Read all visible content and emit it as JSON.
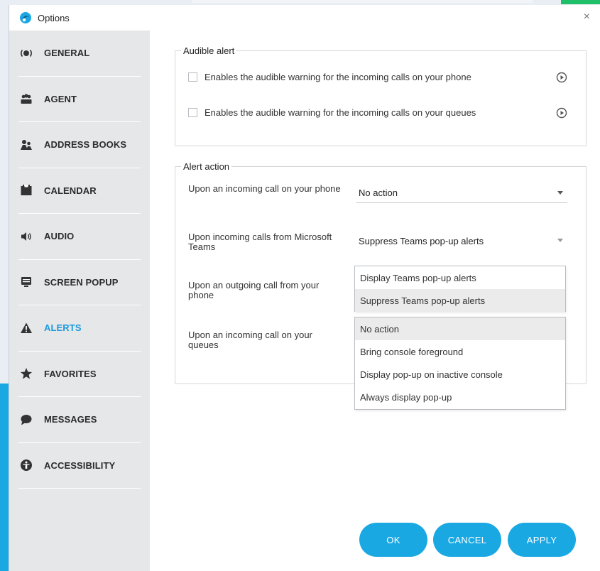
{
  "window": {
    "title": "Options",
    "close_glyph": "×"
  },
  "sidebar": {
    "items": [
      {
        "label": "GENERAL",
        "icon": "radio-icon"
      },
      {
        "label": "AGENT",
        "icon": "agents-icon"
      },
      {
        "label": "ADDRESS BOOKS",
        "icon": "address-book-icon"
      },
      {
        "label": "CALENDAR",
        "icon": "calendar-icon"
      },
      {
        "label": "AUDIO",
        "icon": "speaker-icon"
      },
      {
        "label": "SCREEN POPUP",
        "icon": "screen-popup-icon"
      },
      {
        "label": "ALERTS",
        "icon": "warning-icon",
        "active": true
      },
      {
        "label": "FAVORITES",
        "icon": "star-icon"
      },
      {
        "label": "MESSAGES",
        "icon": "chat-bubble-icon"
      },
      {
        "label": "ACCESSIBILITY",
        "icon": "accessibility-icon"
      }
    ]
  },
  "audible_alert": {
    "legend": "Audible alert",
    "phone_label": "Enables the audible warning for the incoming calls on your phone",
    "queues_label": "Enables the audible warning for the incoming calls on your queues",
    "phone_checked": false,
    "queues_checked": false
  },
  "alert_action": {
    "legend": "Alert action",
    "rows": [
      {
        "label": "Upon an incoming call on your phone",
        "value": "No action"
      },
      {
        "label": "Upon incoming calls from Microsoft Teams",
        "value": "Suppress Teams pop-up alerts"
      },
      {
        "label": "Upon an outgoing call from your phone",
        "value": ""
      },
      {
        "label": "Upon an incoming call on your queues",
        "value": ""
      }
    ]
  },
  "teams_dropdown": {
    "options": [
      "Display Teams pop-up alerts",
      "Suppress Teams pop-up alerts"
    ],
    "selected": "Suppress Teams pop-up alerts"
  },
  "action_dropdown": {
    "options": [
      "No action",
      "Bring console foreground",
      "Display pop-up on inactive console",
      "Always display pop-up"
    ],
    "selected": "No action"
  },
  "buttons": {
    "ok": "OK",
    "cancel": "CANCEL",
    "apply": "APPLY"
  },
  "colors": {
    "accent": "#1aa8e3",
    "active_nav": "#1a9be0",
    "sidebar_bg": "#e6e7e9"
  }
}
